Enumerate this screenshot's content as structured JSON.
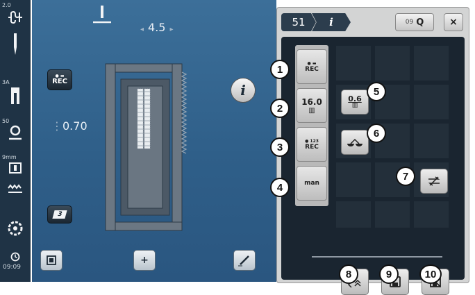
{
  "status_bar": {
    "top_value": "2.0",
    "presser_foot_value": "3A",
    "tension_value": "50",
    "width_value": "9mm",
    "time": "09:09"
  },
  "main": {
    "stitch_width": "4.5",
    "stitch_length": "0.70",
    "rec_label": "REC",
    "sequence_label": "3",
    "info_label": "i"
  },
  "panel": {
    "stitch_number": "51",
    "info_tab_label": "i",
    "search_label": "09",
    "close_label": "×",
    "left_buttons": [
      {
        "label": "REC",
        "sub": ""
      },
      {
        "label": "16.0",
        "sub": ""
      },
      {
        "label": "REC",
        "sub": "123"
      },
      {
        "label": "man",
        "sub": ""
      }
    ],
    "length_value": "0.6"
  },
  "callouts": [
    "1",
    "2",
    "3",
    "4",
    "5",
    "6",
    "7",
    "8",
    "9",
    "10"
  ],
  "colors": {
    "main_bg": "#2f5f89",
    "panel_bg": "#d3d4d4",
    "grid_bg": "#1a2530"
  }
}
